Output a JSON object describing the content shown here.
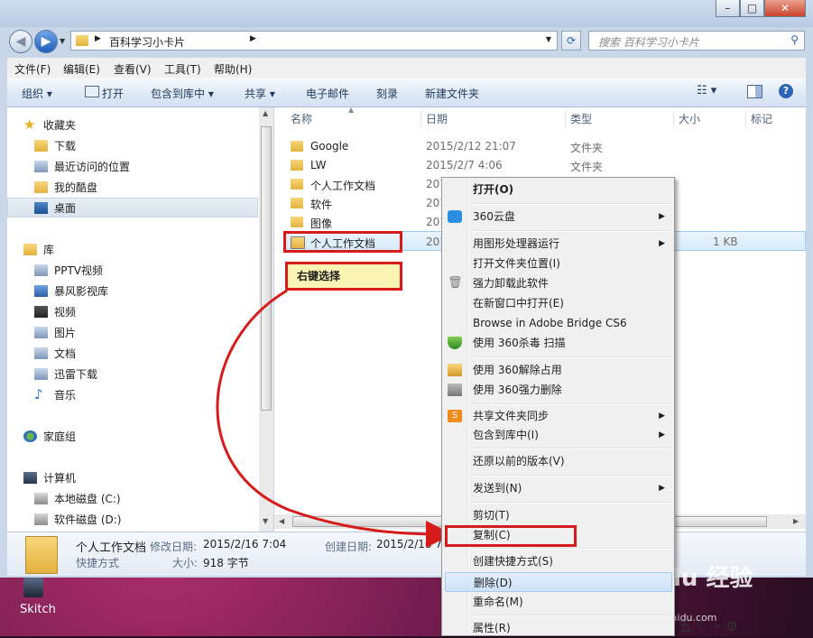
{
  "window": {
    "caption_buttons": [
      "–",
      "□",
      "✕"
    ]
  },
  "address": {
    "path": "百科学习小卡片",
    "search_placeholder": "搜索 百科学习小卡片"
  },
  "menubar": [
    "文件(F)",
    "编辑(E)",
    "查看(V)",
    "工具(T)",
    "帮助(H)"
  ],
  "toolbar": {
    "organize": "组织 ▾",
    "open": "打开",
    "include": "包含到库中 ▾",
    "share": "共享 ▾",
    "email": "电子邮件",
    "burn": "刻录",
    "newfolder": "新建文件夹"
  },
  "navpane": {
    "favorites": {
      "title": "收藏夹",
      "items": [
        "下载",
        "最近访问的位置",
        "我的酷盘",
        "桌面"
      ]
    },
    "libraries": {
      "title": "库",
      "items": [
        "PPTV视频",
        "暴风影视库",
        "视频",
        "图片",
        "文档",
        "迅雷下载",
        "音乐"
      ]
    },
    "homegroup": "家庭组",
    "computer": {
      "title": "计算机",
      "items": [
        "本地磁盘 (C:)",
        "软件磁盘 (D:)"
      ]
    }
  },
  "columns": {
    "name": "名称",
    "date": "日期",
    "type": "类型",
    "size": "大小",
    "tags": "标记"
  },
  "files": [
    {
      "name": "Google",
      "date": "2015/2/12 21:07",
      "type": "文件夹"
    },
    {
      "name": "LW",
      "date": "2015/2/7 4:06",
      "type": "文件夹"
    },
    {
      "name": "个人工作文档",
      "date": "201",
      "type": ""
    },
    {
      "name": "软件",
      "date": "201",
      "type": ""
    },
    {
      "name": "图像",
      "date": "201",
      "type": ""
    },
    {
      "name": "个人工作文档",
      "date": "201",
      "type": "",
      "size": "1 KB"
    }
  ],
  "details": {
    "name": "个人工作文档",
    "kind": "快捷方式",
    "modified_label": "修改日期:",
    "modified": "2015/2/16 7:04",
    "size_label": "大小:",
    "size": "918 字节",
    "created_label": "创建日期:",
    "created": "2015/2/16 7"
  },
  "context_menu": {
    "items": [
      {
        "label": "打开(O)",
        "bold": true
      },
      {
        "label": "360云盘",
        "submenu": true
      },
      {
        "label": "用图形处理器运行",
        "submenu": true
      },
      {
        "label": "打开文件夹位置(I)"
      },
      {
        "label": "强力卸载此软件"
      },
      {
        "label": "在新窗口中打开(E)"
      },
      {
        "label": "Browse in Adobe Bridge CS6"
      },
      {
        "label": "使用 360杀毒 扫描"
      },
      {
        "label": "使用 360解除占用"
      },
      {
        "label": "使用 360强力删除"
      },
      {
        "label": "共享文件夹同步",
        "submenu": true
      },
      {
        "label": "包含到库中(I)",
        "submenu": true
      },
      {
        "label": "还原以前的版本(V)"
      },
      {
        "label": "发送到(N)",
        "submenu": true
      },
      {
        "label": "剪切(T)"
      },
      {
        "label": "复制(C)"
      },
      {
        "label": "创建快捷方式(S)"
      },
      {
        "label": "删除(D)"
      },
      {
        "label": "重命名(M)"
      },
      {
        "label": "属性(R)"
      }
    ]
  },
  "annotation": {
    "callout": "右键选择"
  },
  "desktop": {
    "skitch": "Skitch"
  },
  "watermark": {
    "brand": "Baidu 经验",
    "url": "jingyan.baidu.com"
  },
  "tray": "五 ☾ ∘ ⚙",
  "colors": {
    "annotation_red": "#d71a1a",
    "callout_bg": "#fbf5b3",
    "selection": "#d7ebfc"
  }
}
